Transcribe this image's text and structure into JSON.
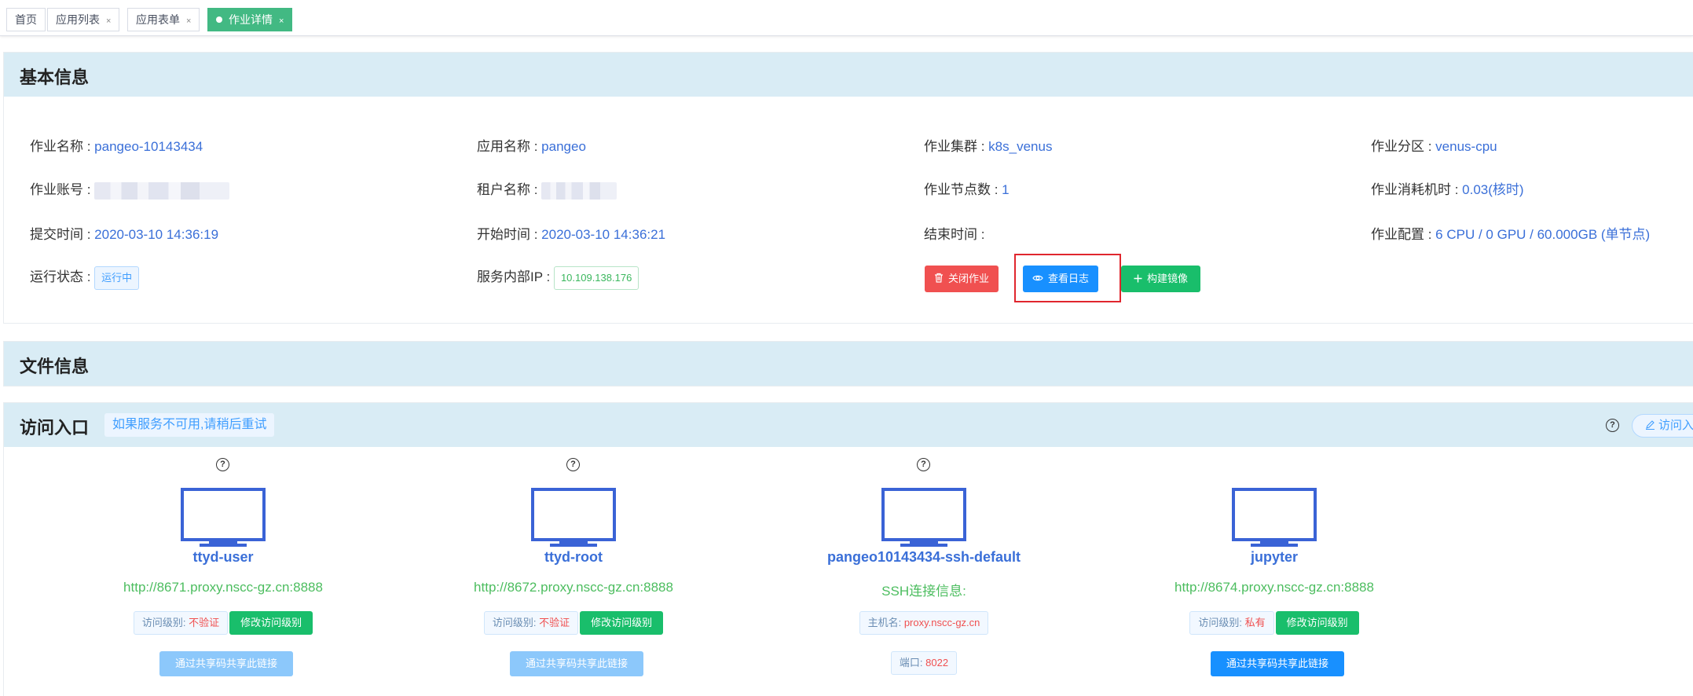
{
  "tabs": [
    {
      "label": "首页",
      "closable": false
    },
    {
      "label": "应用列表",
      "closable": true
    },
    {
      "label": "应用表单",
      "closable": true
    },
    {
      "label": "作业详情",
      "closable": true,
      "active": true
    }
  ],
  "tab_close_glyph": "×",
  "basic": {
    "title": "基本信息",
    "job_name_label": "作业名称 : ",
    "job_name": "pangeo-10143434",
    "app_name_label": "应用名称 : ",
    "app_name": "pangeo",
    "cluster_label": "作业集群 : ",
    "cluster": "k8s_venus",
    "partition_label": "作业分区 : ",
    "partition": "venus-cpu",
    "account_label": "作业账号 : ",
    "tenant_label": "租户名称 : ",
    "nodes_label": "作业节点数 : ",
    "nodes": "1",
    "cost_label": "作业消耗机时 : ",
    "cost": "0.03(核时)",
    "submit_label": "提交时间 : ",
    "submit_time": "2020-03-10 14:36:19",
    "start_label": "开始时间 : ",
    "start_time": "2020-03-10 14:36:21",
    "end_label": "结束时间 : ",
    "config_label": "作业配置 : ",
    "config": "6 CPU / 0 GPU / 60.000GB (单节点)",
    "status_label": "运行状态 : ",
    "status": "运行中",
    "ip_label": "服务内部IP : ",
    "ip": "10.109.138.176",
    "btn_close": "关闭作业",
    "btn_log": "查看日志",
    "btn_build": "构建镜像"
  },
  "files": {
    "title": "文件信息"
  },
  "access": {
    "title": "访问入口",
    "hint": "如果服务不可用,请稍后重试",
    "visit_label": "访问入",
    "entries": [
      {
        "name": "ttyd-user",
        "url": "http://8671.proxy.nscc-gz.cn:8888",
        "level_label": "访问级别: ",
        "level": "不验证",
        "modify": "修改访问级别",
        "share": "通过共享码共享此链接"
      },
      {
        "name": "ttyd-root",
        "url": "http://8672.proxy.nscc-gz.cn:8888",
        "level_label": "访问级别: ",
        "level": "不验证",
        "modify": "修改访问级别",
        "share": "通过共享码共享此链接"
      },
      {
        "name": "pangeo10143434-ssh-default",
        "url": "SSH连接信息:",
        "host_label": "主机名: ",
        "host": "proxy.nscc-gz.cn",
        "port_label": "端口: ",
        "port": "8022"
      },
      {
        "name": "jupyter",
        "url": "http://8674.proxy.nscc-gz.cn:8888",
        "level_label": "访问级别: ",
        "level": "私有",
        "modify": "修改访问级别",
        "share": "通过共享码共享此链接"
      }
    ]
  },
  "colors": {
    "accent_green": "#42b983",
    "link_blue": "#3a6fd8",
    "danger": "#f05050",
    "primary": "#1890ff",
    "success": "#19be6b",
    "section_bg": "#d9ecf5",
    "highlight_border": "#e0262e"
  }
}
